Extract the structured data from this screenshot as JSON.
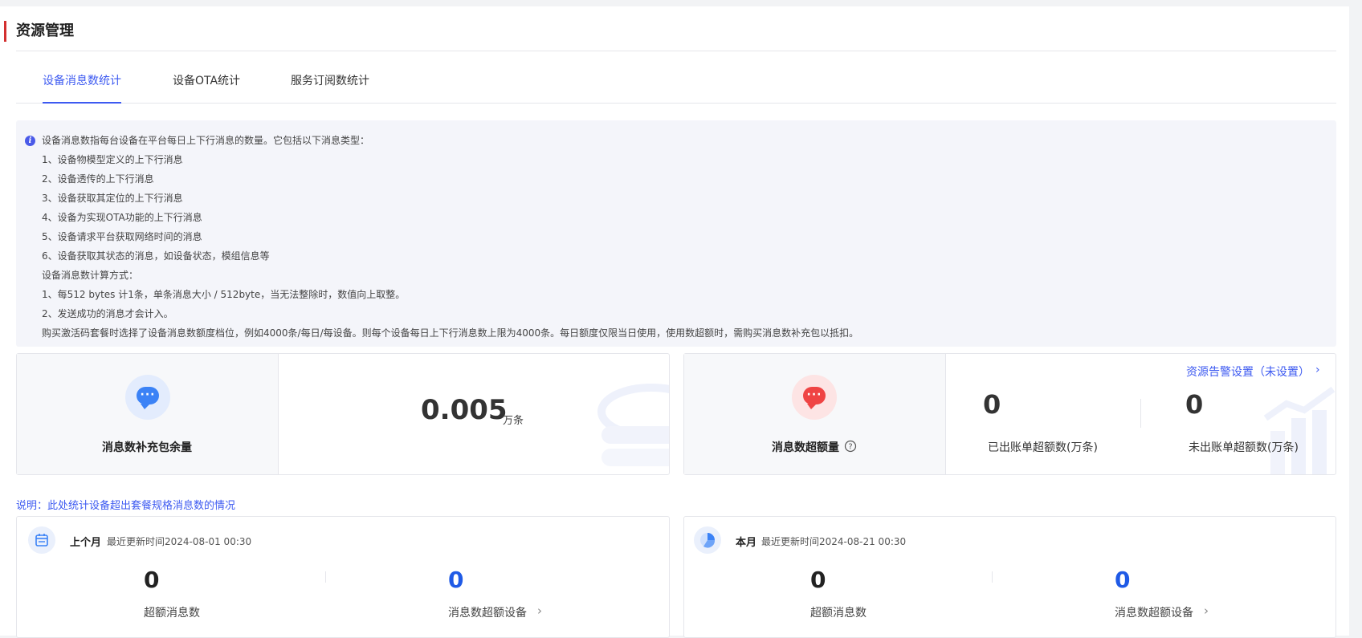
{
  "page": {
    "title": "资源管理"
  },
  "tabs": [
    {
      "label": "设备消息数统计",
      "active": true
    },
    {
      "label": "设备OTA统计",
      "active": false
    },
    {
      "label": "服务订阅数统计",
      "active": false
    }
  ],
  "notice": {
    "lines": [
      "设备消息数指每台设备在平台每日上下行消息的数量。它包括以下消息类型：",
      "1、设备物模型定义的上下行消息",
      "2、设备透传的上下行消息",
      "3、设备获取其定位的上下行消息",
      "4、设备为实现OTA功能的上下行消息",
      "5、设备请求平台获取网络时间的消息",
      "6、设备获取其状态的消息，如设备状态，模组信息等",
      "设备消息数计算方式：",
      "1、每512 bytes 计1条，单条消息大小 / 512byte，当无法整除时，数值向上取整。",
      "2、发送成功的消息才会计入。",
      "购买激活码套餐时选择了设备消息数额度档位，例如4000条/每日/每设备。则每个设备每日上下行消息数上限为4000条。每日额度仅限当日使用，使用数超额时，需购买消息数补充包以抵扣。"
    ]
  },
  "supplement": {
    "label": "消息数补充包余量",
    "value": "0.005",
    "unit": "万条"
  },
  "overage": {
    "label": "消息数超额量",
    "help_icon": "question-circle-icon",
    "alarm_link": "资源告警设置（未设置）",
    "billed": {
      "value": "0",
      "label": "已出账单超额数(万条)"
    },
    "unbilled": {
      "value": "0",
      "label": "未出账单超额数(万条)"
    }
  },
  "note": "说明：此处统计设备超出套餐规格消息数的情况",
  "last_month": {
    "title": "上个月",
    "updated": "最近更新时间2024-08-01 00:30",
    "overage_count": {
      "value": "0",
      "label": "超额消息数"
    },
    "devices": {
      "value": "0",
      "label": "消息数超额设备"
    }
  },
  "this_month": {
    "title": "本月",
    "updated": "最近更新时间2024-08-21 00:30",
    "overage_count": {
      "value": "0",
      "label": "超额消息数"
    },
    "devices": {
      "value": "0",
      "label": "消息数超额设备"
    }
  },
  "colors": {
    "accent": "#3d5af1",
    "title_bar": "#d32f2f",
    "count_blue": "#1f5ae6"
  }
}
